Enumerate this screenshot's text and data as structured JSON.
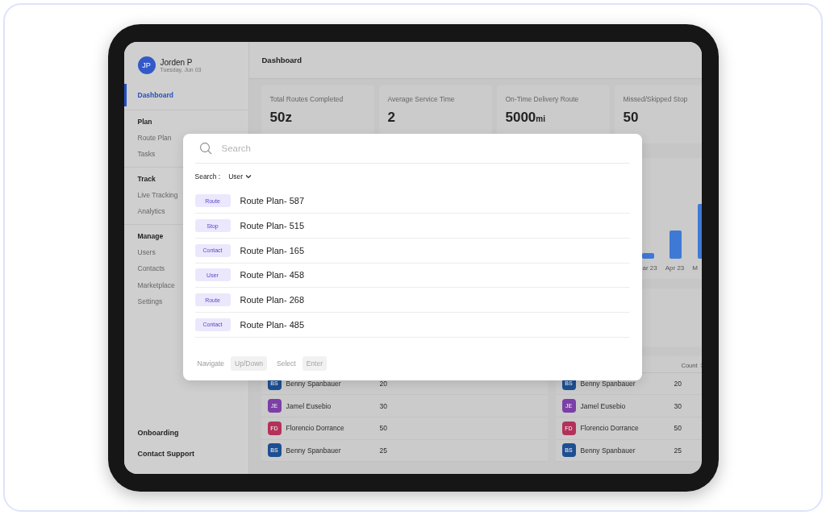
{
  "sidebar": {
    "user": {
      "initials": "JP",
      "name": "Jorden P",
      "date": "Tuesday, Jun 03"
    },
    "items": [
      {
        "label": "Dashboard",
        "selected": true
      }
    ],
    "sections": [
      {
        "title": "Plan",
        "items": [
          {
            "label": "Route Plan",
            "selected": false
          },
          {
            "label": "Tasks",
            "selected": false
          }
        ]
      },
      {
        "title": "Track",
        "items": [
          {
            "label": "Live Tracking",
            "selected": false
          },
          {
            "label": "Analytics",
            "selected": false
          }
        ]
      },
      {
        "title": "Manage",
        "items": [
          {
            "label": "Users",
            "selected": false
          },
          {
            "label": "Contacts",
            "selected": false
          },
          {
            "label": "Marketplace",
            "selected": false
          },
          {
            "label": "Settings",
            "selected": false
          }
        ]
      }
    ],
    "footer": [
      "Onboarding",
      "Contact Support"
    ]
  },
  "header": {
    "title": "Dashboard"
  },
  "stats": [
    {
      "label": "Total Routes Completed",
      "value": "50z"
    },
    {
      "label": "Average Service Time",
      "value": "2"
    },
    {
      "label": "On-Time Delivery Route",
      "value": "5000",
      "unit": "mi"
    },
    {
      "label": "Missed/Skipped Stop",
      "value": "50"
    }
  ],
  "chart": {
    "axis_labels": [
      "ar 23",
      "Apr 23",
      "M"
    ]
  },
  "tables": [
    {
      "rows": [
        {
          "initials": "BS",
          "name": "Benny Spanbauer",
          "count": "20",
          "color": "#1d4f91"
        },
        {
          "initials": "JE",
          "name": "Jamel Eusebio",
          "count": "30",
          "color": "#7b3fa6"
        },
        {
          "initials": "FD",
          "name": "Florencio Dorrance",
          "count": "50",
          "color": "#b3325a"
        },
        {
          "initials": "BS",
          "name": "Benny Spanbauer",
          "count": "25",
          "color": "#1d4f91"
        }
      ]
    },
    {
      "count_header": "Count",
      "rows": [
        {
          "initials": "BS",
          "name": "Benny Spanbauer",
          "count": "20",
          "color": "#1d4f91"
        },
        {
          "initials": "JE",
          "name": "Jamel Eusebio",
          "count": "30",
          "color": "#7b3fa6"
        },
        {
          "initials": "FD",
          "name": "Florencio Dorrance",
          "count": "50",
          "color": "#b3325a"
        },
        {
          "initials": "BS",
          "name": "Benny Spanbauer",
          "count": "25",
          "color": "#1d4f91"
        }
      ]
    }
  ],
  "modal": {
    "search": {
      "placeholder": "Search"
    },
    "filter": {
      "label": "Search :",
      "value": "User"
    },
    "results": [
      {
        "tag": "Route",
        "title": "Route Plan- 587"
      },
      {
        "tag": "Stop",
        "title": "Route Plan- 515"
      },
      {
        "tag": "Contact",
        "title": "Route Plan- 165"
      },
      {
        "tag": "User",
        "title": "Route Plan- 458"
      },
      {
        "tag": "Route",
        "title": "Route Plan- 268"
      },
      {
        "tag": "Contact",
        "title": "Route Plan- 485"
      }
    ],
    "hints": [
      {
        "label": "Navigate",
        "key": "Up/Down"
      },
      {
        "label": "Select",
        "key": "Enter"
      }
    ]
  }
}
